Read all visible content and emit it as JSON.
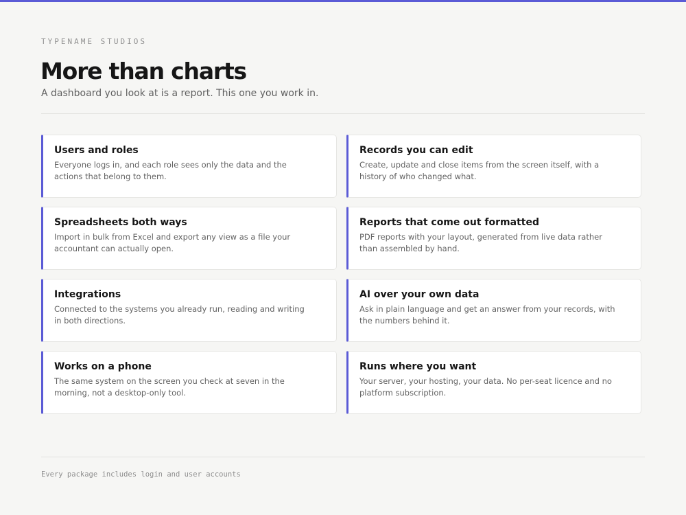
{
  "header": {
    "eyebrow": "TYPENAME STUDIOS",
    "title": "More than charts",
    "subtitle": "A dashboard you look at is a report. This one you work in."
  },
  "features": [
    {
      "title": "Users and roles",
      "description": "Everyone logs in, and each role sees only the data and the actions that belong to them."
    },
    {
      "title": "Records you can edit",
      "description": "Create, update and close items from the screen itself, with a history of who changed what."
    },
    {
      "title": "Spreadsheets both ways",
      "description": "Import in bulk from Excel and export any view as a file your accountant can actually open."
    },
    {
      "title": "Reports that come out formatted",
      "description": "PDF reports with your layout, generated from live data rather than assembled by hand."
    },
    {
      "title": "Integrations",
      "description": "Connected to the systems you already run, reading and writing in both directions."
    },
    {
      "title": "AI over your own data",
      "description": "Ask in plain language and get an answer from your records, with the numbers behind it."
    },
    {
      "title": "Works on a phone",
      "description": "The same system on the screen you check at seven in the morning, not a desktop-only tool."
    },
    {
      "title": "Runs where you want",
      "description": "Your server, your hosting, your data. No per-seat licence and no platform subscription."
    }
  ],
  "footer": {
    "note": "Every package includes login and user accounts"
  },
  "colors": {
    "accent": "#5b5bd6",
    "background": "#f6f6f4",
    "card": "#ffffff"
  }
}
